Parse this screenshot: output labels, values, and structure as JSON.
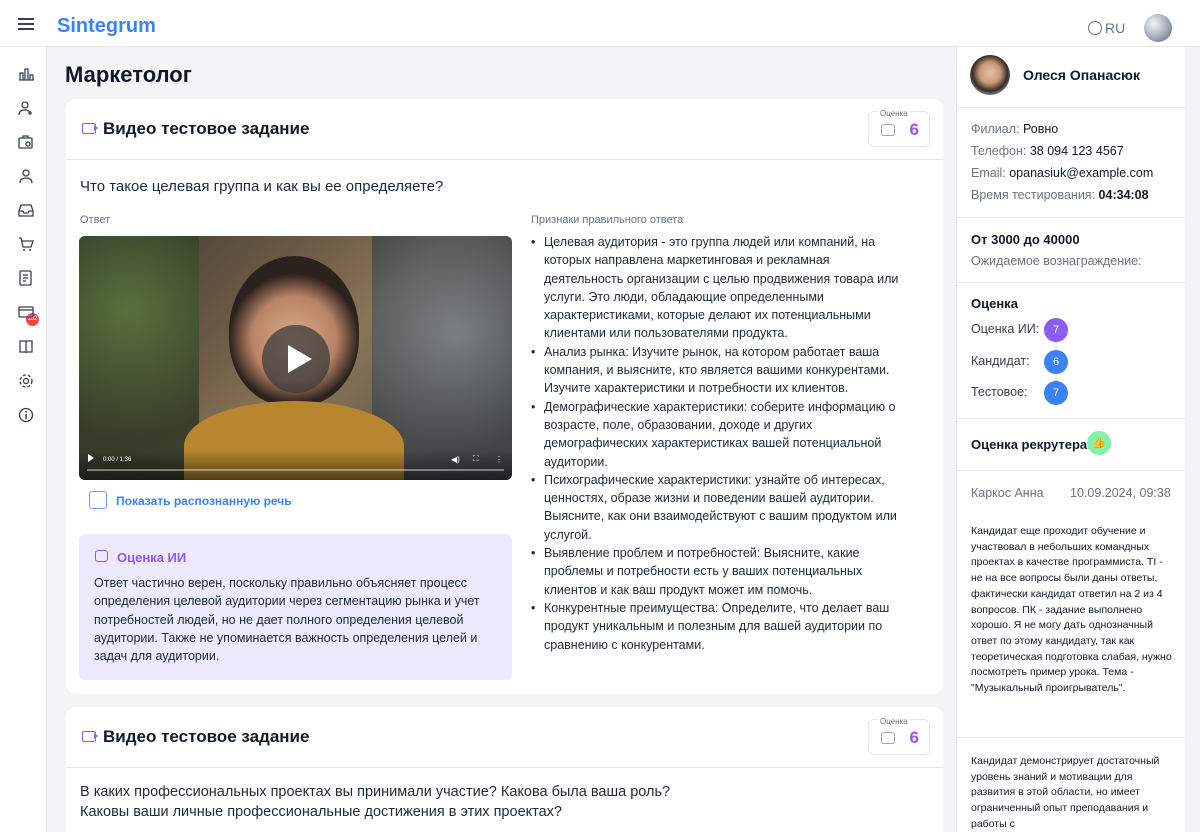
{
  "topbar": {
    "logo": "Sintegrum",
    "lang": "RU"
  },
  "sidebar": {
    "badge": "182"
  },
  "page": {
    "title": "Маркетолог"
  },
  "card1": {
    "title": "Видео тестовое задание",
    "score_label": "Оценка",
    "score": "6",
    "question": "Что такое целевая группа и как вы ее определяете?",
    "answer_label": "Ответ",
    "video_time": "0:00 / 1:36",
    "speech_link": "Показать распознанную речь",
    "ai_title": "Оценка ИИ",
    "ai_text": "Ответ частично верен, поскольку правильно объясняет процесс определения целевой аудитории через сегментацию рынка и учет потребностей людей, но не дает полного определения целевой аудитории. Также не упоминается важность определения целей и задач для аудитории.",
    "signs_label": "Признаки правильного ответа",
    "signs": [
      "Целевая аудитория - это группа людей или компаний, на которых направлена маркетинговая и рекламная деятельность организации с целью продвижения товара или услуги. Это люди, обладающие определенными характеристиками, которые делают их потенциальными клиентами или пользователями продукта.",
      "Анализ рынка: Изучите рынок, на котором работает ваша компания, и выясните, кто является вашими конкурентами. Изучите характеристики и потребности их клиентов.",
      "Демографические характеристики: соберите информацию о возрасте, поле, образовании, доходе и других демографических характеристиках вашей потенциальной аудитории.",
      "Психографические характеристики: узнайте об интересах, ценностях, образе жизни и поведении вашей аудитории. Выясните, как они взаимодействуют с вашим продуктом или услугой.",
      "Выявление проблем и потребностей: Выясните, какие проблемы и потребности есть у ваших потенциальных клиентов и как ваш продукт может им помочь.",
      "Конкурентные преимущества: Определите, что делает ваш продукт уникальным и полезным для вашей аудитории по сравнению с конкурентами."
    ]
  },
  "card2": {
    "title": "Видео тестовое задание",
    "score_label": "Оценка",
    "score": "6",
    "question": "В каких профессиональных проектах вы принимали участие? Какова была ваша роль? Каковы ваши личные профессиональные достижения в этих проектах?"
  },
  "candidate": {
    "name": "Олеся Опанасюк",
    "branch_label": "Филиал:",
    "branch": "Ровно",
    "phone_label": "Телефон:",
    "phone": "38 094 123 4567",
    "email_label": "Email:",
    "email": "opanasiuk@example.com",
    "time_label": "Время тестирования:",
    "time": "04:34:08",
    "salary": "От 3000 до 40000",
    "salary_label": "Ожидаемое вознаграждение:",
    "rating_title": "Оценка",
    "ai_label": "Оценка ИИ:",
    "ai_score": "7",
    "cand_label": "Кандидат:",
    "cand_score": "6",
    "test_label": "Тестовое:",
    "test_score": "7",
    "recruiter_label": "Оценка рекрутера:",
    "reviewer": "Каркос Анна",
    "review_date": "10.09.2024, 09:38",
    "comment1": "Кандидат еще проходит обучение и участвовал в небольших командных проектах в качестве программиста. TI - не на все вопросы были даны ответы, фактически кандидат ответил на 2 из 4 вопросов. ПК - задание выполнено хорошо. Я не могу дать однозначный ответ по этому кандидату, так как теоретическая подготовка слабая, нужно посмотреть пример урока. Тема - \"Музыкальный проигрыватель\".",
    "comment2": "Кандидат демонстрирует достаточный уровень знаний и мотивации для развития в этой области, но имеет ограниченный опыт преподавания и работы с"
  },
  "colors": {
    "accent": "#3b82f6",
    "purple": "#8b5cf6",
    "ai_bg": "#ede9fe"
  }
}
